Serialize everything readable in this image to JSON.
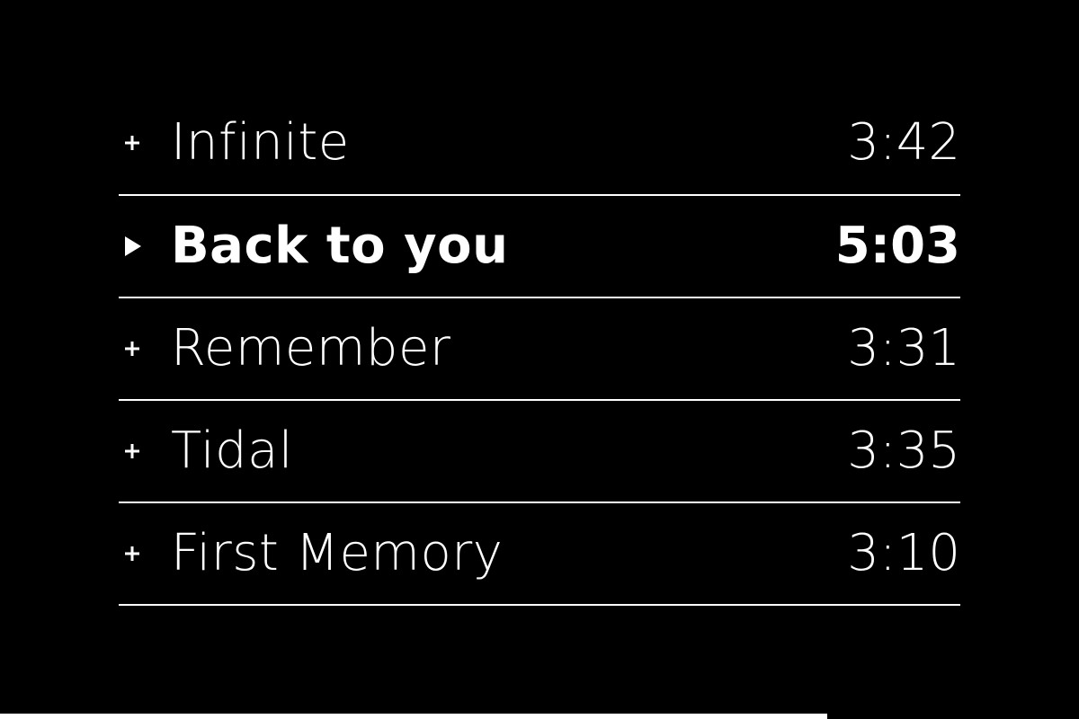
{
  "tracks": [
    {
      "title": "Infinite",
      "duration": "3:42",
      "icon": "plus-icon",
      "active": false
    },
    {
      "title": "Back to you",
      "duration": "5:03",
      "icon": "play-icon",
      "active": true
    },
    {
      "title": "Remember",
      "duration": "3:31",
      "icon": "plus-icon",
      "active": false
    },
    {
      "title": "Tidal",
      "duration": "3:35",
      "icon": "plus-icon",
      "active": false
    },
    {
      "title": "First Memory",
      "duration": "3:10",
      "icon": "plus-icon",
      "active": false
    }
  ],
  "playback": {
    "progress_fraction": 0.767
  },
  "colors": {
    "background": "#000000",
    "foreground": "#ffffff"
  }
}
